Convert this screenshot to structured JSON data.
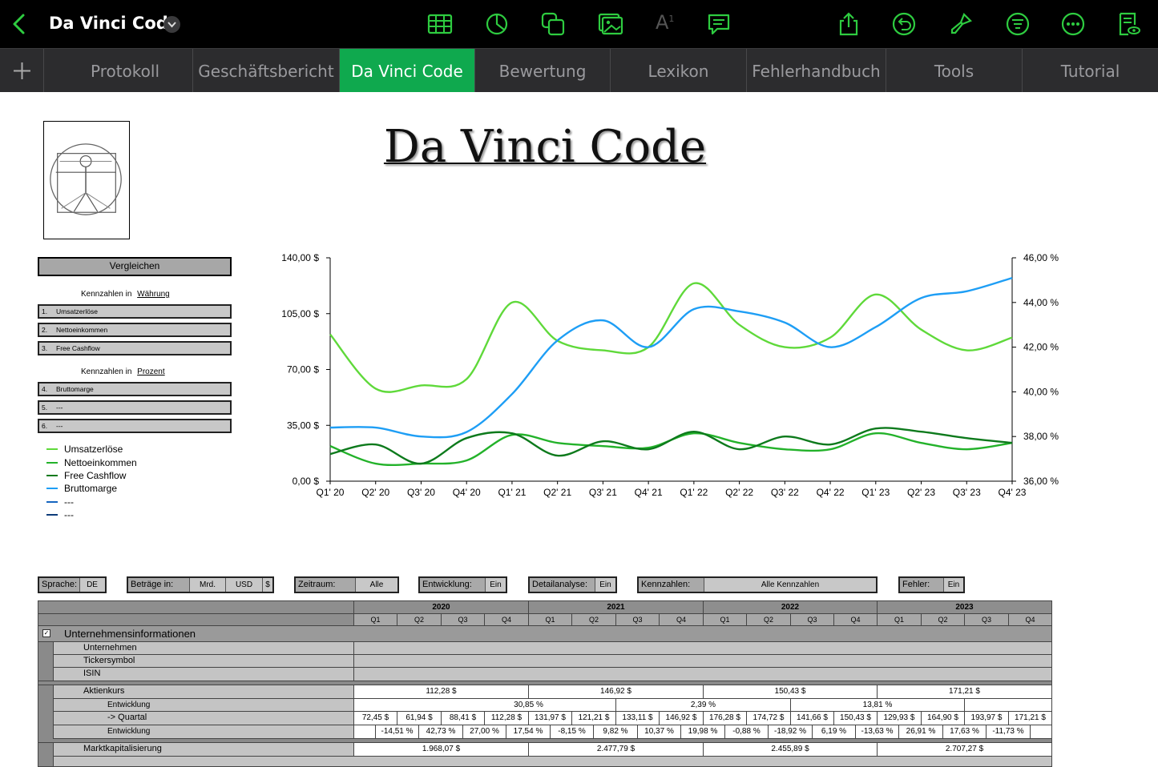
{
  "toolbar": {
    "title": "Da Vinci Code",
    "icons": [
      "table-icon",
      "chart-icon",
      "shape-icon",
      "media-icon",
      "text-format-icon",
      "comment-icon",
      "share-icon",
      "undo-icon",
      "brush-icon",
      "organize-icon",
      "more-icon",
      "document-view-icon"
    ]
  },
  "tabs": [
    {
      "label": "Protokoll",
      "active": false
    },
    {
      "label": "Geschäftsbericht",
      "active": false
    },
    {
      "label": "Da Vinci Code",
      "active": true
    },
    {
      "label": "Bewertung",
      "active": false
    },
    {
      "label": "Lexikon",
      "active": false
    },
    {
      "label": "Fehlerhandbuch",
      "active": false
    },
    {
      "label": "Tools",
      "active": false
    },
    {
      "label": "Tutorial",
      "active": false
    }
  ],
  "page": {
    "heading": "Da Vinci Code",
    "compare_button": "Vergleichen",
    "currency_header": "Kennzahlen in",
    "currency_link": "Währung",
    "percent_header": "Kennzahlen in",
    "percent_link": "Prozent",
    "currency_items": [
      {
        "n": "1.",
        "label": "Umsatzerlöse"
      },
      {
        "n": "2.",
        "label": "Nettoeinkommen"
      },
      {
        "n": "3.",
        "label": "Free Cashflow"
      }
    ],
    "percent_items": [
      {
        "n": "4.",
        "label": "Bruttomarge"
      },
      {
        "n": "5.",
        "label": "---"
      },
      {
        "n": "6.",
        "label": "---"
      }
    ],
    "legend": [
      {
        "label": "Umsatzerlöse",
        "color": "#5fd93a"
      },
      {
        "label": "Nettoeinkommen",
        "color": "#23b22a"
      },
      {
        "label": "Free Cashflow",
        "color": "#0d7a1c"
      },
      {
        "label": "Bruttomarge",
        "color": "#1e9ef5"
      },
      {
        "label": "---",
        "color": "#1565c0"
      },
      {
        "label": "---",
        "color": "#0d3c7a"
      }
    ]
  },
  "chart_data": {
    "type": "line",
    "categories": [
      "Q1' 20",
      "Q2' 20",
      "Q3' 20",
      "Q4' 20",
      "Q1' 21",
      "Q2' 21",
      "Q3' 21",
      "Q4' 21",
      "Q1' 22",
      "Q2' 22",
      "Q3' 22",
      "Q4' 22",
      "Q1' 23",
      "Q2' 23",
      "Q3' 23",
      "Q4' 23"
    ],
    "y_left": {
      "ticks": [
        "0,00 $",
        "35,00 $",
        "70,00 $",
        "105,00 $",
        "140,00 $"
      ],
      "range": [
        0,
        140
      ]
    },
    "y_right": {
      "ticks": [
        "36,00 %",
        "38,00 %",
        "40,00 %",
        "42,00 %",
        "44,00 %",
        "46,00 %"
      ],
      "range": [
        36,
        46
      ]
    },
    "series": [
      {
        "name": "Umsatzerlöse",
        "axis": "left",
        "color": "#5fd93a",
        "values": [
          92,
          58,
          60,
          64,
          112,
          88,
          82,
          84,
          124,
          98,
          84,
          90,
          117,
          95,
          82,
          90
        ]
      },
      {
        "name": "Nettoeinkommen",
        "axis": "left",
        "color": "#23b22a",
        "values": [
          22,
          11,
          11,
          13,
          29,
          24,
          22,
          21,
          30,
          24,
          20,
          20,
          30,
          24,
          20,
          24
        ]
      },
      {
        "name": "Free Cashflow",
        "axis": "left",
        "color": "#0d7a1c",
        "values": [
          17,
          23,
          11,
          27,
          30,
          16,
          25,
          20,
          31,
          20,
          28,
          23,
          33,
          31,
          27,
          24
        ]
      },
      {
        "name": "Bruttomarge",
        "axis": "right",
        "color": "#1e9ef5",
        "values": [
          38.4,
          38.4,
          38.0,
          38.2,
          39.9,
          42.3,
          43.2,
          42.0,
          43.7,
          43.6,
          43.1,
          42.0,
          42.9,
          44.2,
          44.5,
          45.1
        ]
      }
    ]
  },
  "filters": [
    {
      "label": "Sprache:",
      "values": [
        "DE"
      ]
    },
    {
      "label": "Beträge in:",
      "values": [
        "Mrd.",
        "USD",
        "$"
      ]
    },
    {
      "label": "Zeitraum:",
      "values": [
        "Alle"
      ]
    },
    {
      "label": "Entwicklung:",
      "values": [
        "Ein"
      ]
    },
    {
      "label": "Detailanalyse:",
      "values": [
        "Ein"
      ]
    },
    {
      "label": "Kennzahlen:",
      "values": [
        "Alle Kennzahlen"
      ]
    },
    {
      "label": "Fehler:",
      "values": [
        "Ein"
      ]
    }
  ],
  "table": {
    "years": [
      "2020",
      "2021",
      "2022",
      "2023"
    ],
    "quarters": [
      "Q1",
      "Q2",
      "Q3",
      "Q4"
    ],
    "section": "Unternehmensinformationen",
    "info_rows": [
      "Unternehmen",
      "Tickersymbol",
      "ISIN"
    ],
    "aktienkurs": {
      "label": "Aktienkurs",
      "yearly": [
        "112,28 $",
        "146,92 $",
        "150,43 $",
        "171,21 $"
      ],
      "entwicklung_label": "Entwicklung",
      "entwicklung_year": [
        "30,85 %",
        "2,39 %",
        "13,81 %"
      ],
      "quartal_label": "-> Quartal",
      "quartal": [
        "72,45 $",
        "61,94 $",
        "88,41 $",
        "112,28 $",
        "131,97 $",
        "121,21 $",
        "133,11 $",
        "146,92 $",
        "176,28 $",
        "174,72 $",
        "141,66 $",
        "150,43 $",
        "129,93 $",
        "164,90 $",
        "193,97 $",
        "171,21 $"
      ],
      "entwicklung_quartal": [
        "-14,51 %",
        "42,73 %",
        "27,00 %",
        "17,54 %",
        "-8,15 %",
        "9,82 %",
        "10,37 %",
        "19,98 %",
        "-0,88 %",
        "-18,92 %",
        "6,19 %",
        "-13,63 %",
        "26,91 %",
        "17,63 %",
        "-11,73 %"
      ]
    },
    "marktkap": {
      "label": "Marktkapitalisierung",
      "yearly": [
        "1.968,07 $",
        "2.477,79 $",
        "2.455,89 $",
        "2.707,27 $"
      ]
    }
  }
}
